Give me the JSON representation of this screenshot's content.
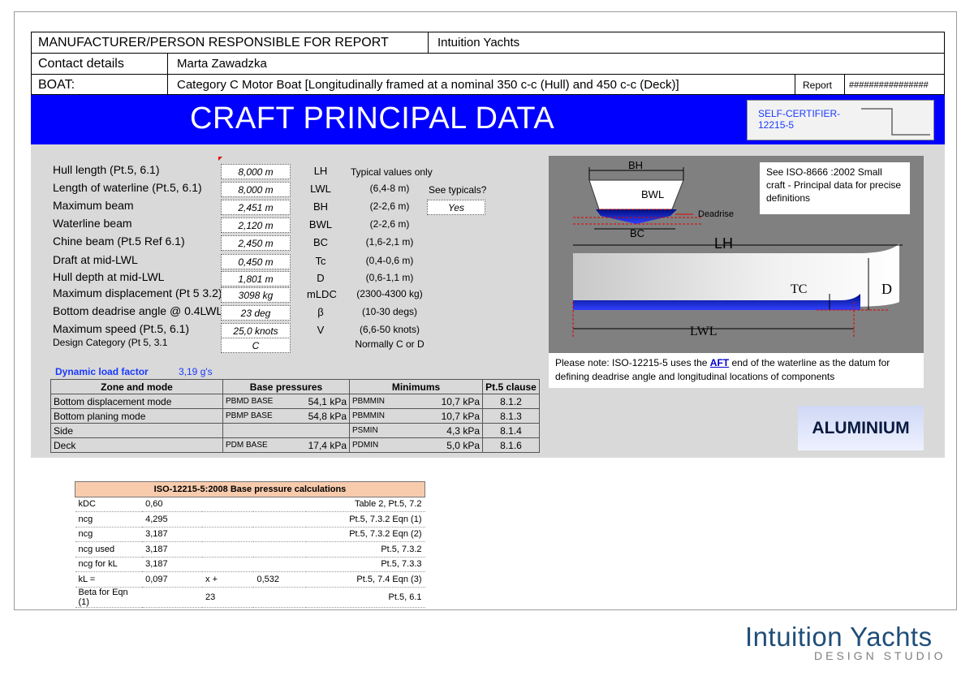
{
  "header": {
    "manufacturer_label": "MANUFACTURER/PERSON RESPONSIBLE FOR REPORT",
    "manufacturer_value": "Intuition Yachts",
    "contact_label": "Contact details",
    "contact_value": "Marta Zawadzka",
    "boat_label": "BOAT:",
    "boat_value": "Category C Motor Boat [Longitudinally framed at a nominal 350 c-c (Hull) and 450 c-c (Deck)]",
    "report_label": "Report",
    "report_value": "################"
  },
  "title": "CRAFT PRINCIPAL DATA",
  "self_certifier": "SELF-CERTIFIER-12215-5",
  "principal": {
    "typical_header": "Typical values only",
    "see_typicals_label": "See typicals?",
    "see_typicals_value": "Yes",
    "rows": [
      {
        "label": "Hull length  (Pt.5,  6.1)",
        "value": "8,000 m",
        "symbol": "LH",
        "typical": ""
      },
      {
        "label": "Length of waterline (Pt.5, 6.1)",
        "value": "8,000 m",
        "symbol": "LWL",
        "typical": "(6,4-8 m)"
      },
      {
        "label": "Maximum beam",
        "value": "2,451 m",
        "symbol": "BH",
        "typical": "(2-2,6 m)"
      },
      {
        "label": "Waterline beam",
        "value": "2,120 m",
        "symbol": "BWL",
        "typical": "(2-2,6 m)"
      },
      {
        "label": "Chine beam (Pt.5 Ref 6.1)",
        "value": "2,450 m",
        "symbol": "BC",
        "typical": "(1,6-2,1 m)"
      },
      {
        "label": "Draft at mid-LWL",
        "value": "0,450 m",
        "symbol": "Tc",
        "typical": "(0,4-0,6 m)"
      },
      {
        "label": "Hull depth at mid-LWL",
        "value": "1,801 m",
        "symbol": "D",
        "typical": "(0,6-1,1 m)"
      },
      {
        "label": "Maximum displacement (Pt 5 3.2)",
        "value": "3098 kg",
        "symbol": "mLDC",
        "typical": "(2300-4300 kg)"
      },
      {
        "label": "Bottom deadrise angle @ 0.4LWL",
        "value": "23 deg",
        "symbol": "β",
        "typical": "(10-30 degs)"
      },
      {
        "label": "Maximum speed (Pt.5, 6.1)",
        "value": "25,0 knots",
        "symbol": "V",
        "typical": "(6,6-50 knots)"
      },
      {
        "label": "Design Category (Pt 5, 3.1",
        "value": "C",
        "symbol": "",
        "typical": "Normally C or D"
      }
    ]
  },
  "sketch": {
    "labels": {
      "bh": "BH",
      "bwl": "BWL",
      "bc": "BC",
      "deadrise": "Deadrise",
      "lh": "LH",
      "lwl": "LWL",
      "tc": "TC",
      "d": "D"
    },
    "note_top": "See ISO-8666 :2002  Small craft - Principal data for precise definitions",
    "note_bottom_pre": "Please note: ISO-12215-5 uses the ",
    "note_bottom_aft": "AFT",
    "note_bottom_post": " end of the waterline as the datum for defining deadrise angle and longitudinal locations of components"
  },
  "material": "ALUMINIUM",
  "dynamic_load": {
    "label": "Dynamic load factor",
    "value": "3,19 g's"
  },
  "pressure_table": {
    "headers": [
      "Zone and mode",
      "Base pressures",
      "Minimums",
      "Pt.5 clause"
    ],
    "rows": [
      {
        "zone": "Bottom displacement mode",
        "bsym": "PBMD BASE",
        "bval": "54,1 kPa",
        "msym": "PBMMIN",
        "mval": "10,7 kPa",
        "clause": "8.1.2"
      },
      {
        "zone": "Bottom planing mode",
        "bsym": "PBMP BASE",
        "bval": "54,8 kPa",
        "msym": "PBMMIN",
        "mval": "10,7 kPa",
        "clause": "8.1.3"
      },
      {
        "zone": "Side",
        "bsym": "",
        "bval": "",
        "msym": "PSMIN",
        "mval": "4,3 kPa",
        "clause": "8.1.4"
      },
      {
        "zone": "Deck",
        "bsym": "PDM BASE",
        "bval": "17,4 kPa",
        "msym": "PDMIN",
        "mval": "5,0 kPa",
        "clause": "8.1.6"
      }
    ]
  },
  "base_calc": {
    "title": "ISO-12215-5:2008 Base pressure calculations",
    "rows": [
      {
        "sym": "kDC",
        "val": "0,60",
        "mid": "",
        "val2": "",
        "ref": "Table 2, Pt.5, 7.2"
      },
      {
        "sym": "ncg",
        "val": "4,295",
        "mid": "",
        "val2": "",
        "ref": "Pt.5, 7.3.2 Eqn (1)"
      },
      {
        "sym": "ncg",
        "val": "3,187",
        "mid": "",
        "val2": "",
        "ref": "Pt.5, 7.3.2 Eqn (2)"
      },
      {
        "sym": "ncg used",
        "val": "3,187",
        "mid": "",
        "val2": "",
        "ref": "Pt.5, 7.3.2"
      },
      {
        "sym": "ncg for kL",
        "val": "3,187",
        "mid": "",
        "val2": "",
        "ref": "Pt.5, 7.3.3"
      },
      {
        "sym": "kL =",
        "val": "0,097",
        "mid": "x  +",
        "val2": "0,532",
        "ref": "Pt.5, 7.4 Eqn (3)"
      },
      {
        "sym": "Beta for Eqn (1)",
        "val": "",
        "mid": "23",
        "val2": "",
        "ref": "Pt.5, 6.1"
      }
    ]
  },
  "footer": {
    "brand": "Intuition Yachts",
    "sub": "DESIGN STUDIO"
  }
}
